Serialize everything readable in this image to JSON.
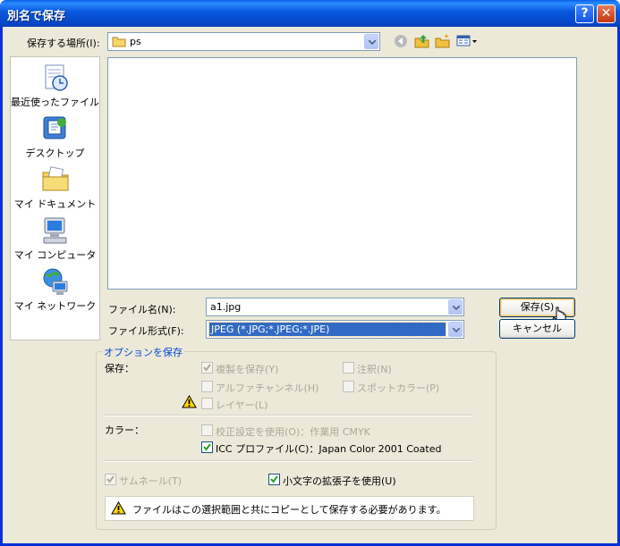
{
  "window": {
    "title": "別名で保存",
    "help_label": "?",
    "close_label": "✕"
  },
  "location": {
    "label": "保存する場所(I):",
    "value": "ps"
  },
  "places": [
    {
      "label": "最近使ったファイル",
      "icon": "recent-files-icon"
    },
    {
      "label": "デスクトップ",
      "icon": "desktop-icon"
    },
    {
      "label": "マイ ドキュメント",
      "icon": "my-documents-icon"
    },
    {
      "label": "マイ コンピュータ",
      "icon": "my-computer-icon"
    },
    {
      "label": "マイ ネットワーク",
      "icon": "my-network-icon"
    }
  ],
  "filename": {
    "label": "ファイル名(N):",
    "value": "a1.jpg"
  },
  "filetype": {
    "label": "ファイル形式(F):",
    "value": "JPEG (*.JPG;*.JPEG;*.JPE)"
  },
  "buttons": {
    "save": "保存(S)",
    "cancel": "キャンセル"
  },
  "options": {
    "group_title": "オプションを保存",
    "save_label": "保存：",
    "duplicate": {
      "label": "複製を保存(Y)",
      "checked": true,
      "enabled": false
    },
    "notes": {
      "label": "注釈(N)",
      "checked": false,
      "enabled": false
    },
    "alpha": {
      "label": "アルファチャンネル(H)",
      "checked": false,
      "enabled": false
    },
    "spot": {
      "label": "スポットカラー(P)",
      "checked": false,
      "enabled": false
    },
    "layers": {
      "label": "レイヤー(L)",
      "checked": false,
      "enabled": false
    },
    "color_label": "カラー：",
    "proof": {
      "label": "校正設定を使用(O)：作業用 CMYK",
      "checked": false,
      "enabled": false
    },
    "icc": {
      "label": "ICC プロファイル(C)：Japan Color 2001 Coated",
      "checked": true,
      "enabled": true
    },
    "thumbnail": {
      "label": "サムネール(T)",
      "checked": true,
      "enabled": false
    },
    "lowercase": {
      "label": "小文字の拡張子を使用(U)",
      "checked": true,
      "enabled": true
    },
    "warning": "ファイルはこの選択範囲と共にコピーとして保存する必要があります。"
  },
  "colors": {
    "title_bar": "#0a5fe8",
    "dialog_bg": "#ece9d8",
    "selection": "#316ac5",
    "group_title": "#0046d5"
  }
}
